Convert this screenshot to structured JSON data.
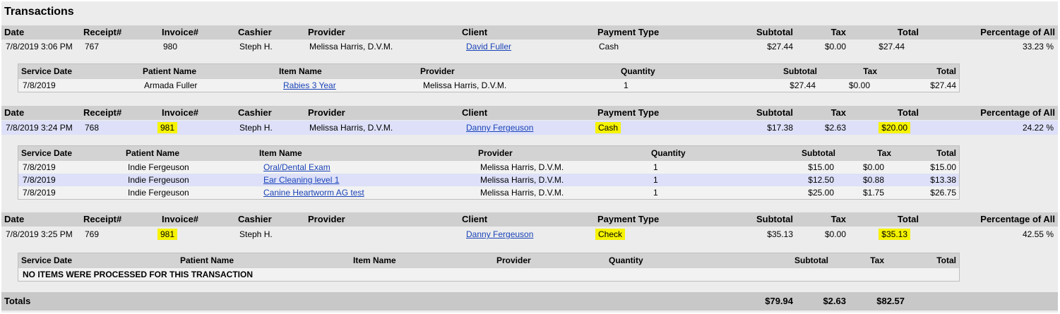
{
  "title": "Transactions",
  "header": {
    "date": "Date",
    "receipt": "Receipt#",
    "invoice": "Invoice#",
    "cashier": "Cashier",
    "provider": "Provider",
    "client": "Client",
    "payment_type": "Payment Type",
    "subtotal": "Subtotal",
    "tax": "Tax",
    "total": "Total",
    "percentage": "Percentage of All"
  },
  "sub_header": {
    "service_date": "Service Date",
    "patient_name": "Patient Name",
    "item_name": "Item Name",
    "provider": "Provider",
    "quantity": "Quantity",
    "subtotal": "Subtotal",
    "tax": "Tax",
    "total": "Total"
  },
  "transactions": [
    {
      "date": "7/8/2019 3:06 PM",
      "receipt": "767",
      "invoice": "980",
      "cashier": "Steph H.",
      "provider": "Melissa Harris, D.V.M.",
      "client": "David Fuller",
      "payment_type": "Cash",
      "subtotal": "$27.44",
      "tax": "$0.00",
      "total": "$27.44",
      "percentage": "33.23 %",
      "items": [
        {
          "service_date": "7/8/2019",
          "patient_name": "Armada Fuller",
          "item_name": "Rabies 3 Year",
          "provider": "Melissa Harris, D.V.M.",
          "quantity": "1",
          "subtotal": "$27.44",
          "tax": "$0.00",
          "total": "$27.44"
        }
      ]
    },
    {
      "date": "7/8/2019 3:24 PM",
      "receipt": "768",
      "invoice": "981",
      "cashier": "Steph H.",
      "provider": "Melissa Harris, D.V.M.",
      "client": "Danny Fergeuson",
      "payment_type": "Cash",
      "subtotal": "$17.38",
      "tax": "$2.63",
      "total": "$20.00",
      "percentage": "24.22 %",
      "items": [
        {
          "service_date": "7/8/2019",
          "patient_name": "Indie Fergeuson",
          "item_name": "Oral/Dental Exam",
          "provider": "Melissa Harris, D.V.M.",
          "quantity": "1",
          "subtotal": "$15.00",
          "tax": "$0.00",
          "total": "$15.00"
        },
        {
          "service_date": "7/8/2019",
          "patient_name": "Indie Fergeuson",
          "item_name": "Ear Cleaning level 1",
          "provider": "Melissa Harris, D.V.M.",
          "quantity": "1",
          "subtotal": "$12.50",
          "tax": "$0.88",
          "total": "$13.38"
        },
        {
          "service_date": "7/8/2019",
          "patient_name": "Indie Fergeuson",
          "item_name": "Canine Heartworm AG test",
          "provider": "Melissa Harris, D.V.M.",
          "quantity": "1",
          "subtotal": "$25.00",
          "tax": "$1.75",
          "total": "$26.75"
        }
      ]
    },
    {
      "date": "7/8/2019 3:25 PM",
      "receipt": "769",
      "invoice": "981",
      "cashier": "Steph H.",
      "provider": "",
      "client": "Danny Fergeuson",
      "payment_type": "Check",
      "subtotal": "$35.13",
      "tax": "$0.00",
      "total": "$35.13",
      "percentage": "42.55 %",
      "no_items_text": "NO ITEMS WERE PROCESSED FOR THIS TRANSACTION"
    }
  ],
  "totals": {
    "label": "Totals",
    "subtotal": "$79.94",
    "tax": "$2.63",
    "total": "$82.57"
  },
  "colors": {
    "highlight": "#f6f300",
    "link": "#1a43b8",
    "row_highlight": "#dde0f8"
  }
}
